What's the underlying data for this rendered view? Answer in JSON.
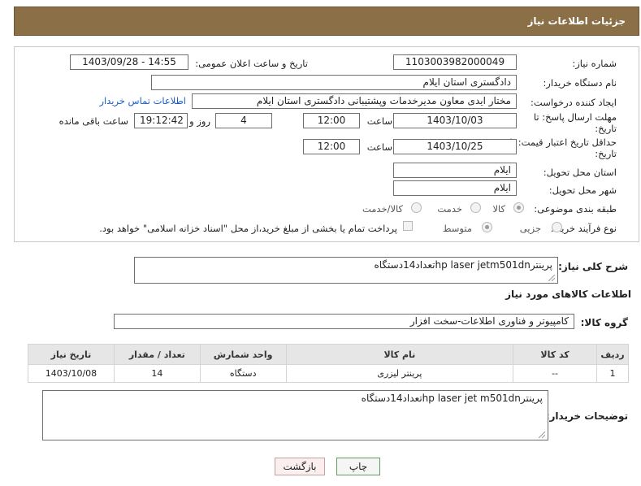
{
  "header": {
    "title": "جزئیات اطلاعات نیاز"
  },
  "form": {
    "need_number_label": "شماره نیاز:",
    "need_number": "1103003982000049",
    "announce_label": "تاریخ و ساعت اعلان عمومی:",
    "announce_value": "1403/09/28 - 14:55",
    "buyer_label": "نام دستگاه خریدار:",
    "buyer_value": "دادگستری استان ایلام",
    "creator_label": "ایجاد کننده درخواست:",
    "creator_value": "مختار ایدی معاون مدیرخدمات وپشتیبانی دادگستری استان ایلام",
    "contact_link": "اطلاعات تماس خریدار",
    "deadline_label_1": "مهلت ارسال پاسخ: تا",
    "deadline_label_2": "تاریخ:",
    "deadline_date": "1403/10/03",
    "hour_label": "ساعت",
    "deadline_time": "12:00",
    "days_value": "4",
    "days_label": "روز و",
    "remaining_time": "19:12:42",
    "remaining_label": "ساعت باقی مانده",
    "validity_label_1": "حداقل تاریخ اعتبار قیمت: تا",
    "validity_label_2": "تاریخ:",
    "validity_date": "1403/10/25",
    "validity_hour_label": "ساعت",
    "validity_time": "12:00",
    "province_label": "استان محل تحویل:",
    "province_value": "ایلام",
    "city_label": "شهر محل تحویل:",
    "city_value": "ایلام",
    "category_label": "طبقه بندی موضوعی:",
    "category_options": [
      "کالا",
      "خدمت",
      "کالا/خدمت"
    ],
    "process_label": "نوع فرآیند خرید :",
    "process_options": [
      "جزیی",
      "متوسط"
    ],
    "payment_note": "پرداخت تمام یا بخشی از مبلغ خرید،از محل \"اسناد خزانه اسلامی\" خواهد بود."
  },
  "summary": {
    "label": "شرح کلی نیاز:",
    "value": "پرینترhp laser jetm501dnتعداد14دستگاه"
  },
  "goods": {
    "section_title": "اطلاعات کالاهای مورد نیاز",
    "group_label": "گروه کالا:",
    "group_value": "کامپیوتر و فناوری اطلاعات-سخت افزار",
    "columns": [
      "ردیف",
      "کد کالا",
      "نام کالا",
      "واحد شمارش",
      "تعداد / مقدار",
      "تاریخ نیاز"
    ],
    "rows": [
      {
        "row": "1",
        "code": "--",
        "name": "پرینتر لیزری",
        "unit": "دستگاه",
        "qty": "14",
        "date": "1403/10/08"
      }
    ]
  },
  "buyer_notes": {
    "label": "توضیحات خریدار:",
    "value": "پرینترhp laser jet m501dnتعداد14دستگاه"
  },
  "buttons": {
    "print": "چاپ",
    "back": "بازگشت"
  }
}
